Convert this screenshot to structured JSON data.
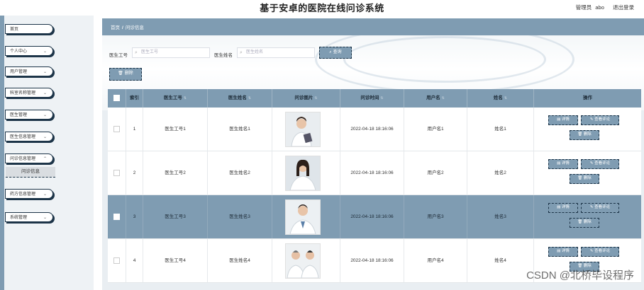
{
  "app": {
    "title": "基于安卓的医院在线问诊系统"
  },
  "topbar": {
    "role": "管理员",
    "username": "abo",
    "logout_label": "退出登录"
  },
  "sidebar": {
    "items": [
      {
        "label": "首页",
        "has_chevron": false
      },
      {
        "label": "个人中心",
        "has_chevron": true
      },
      {
        "label": "用户管理",
        "has_chevron": true
      },
      {
        "label": "科室名称管理",
        "has_chevron": true
      },
      {
        "label": "医生管理",
        "has_chevron": true
      },
      {
        "label": "医生信息管理",
        "has_chevron": true
      },
      {
        "label": "问诊信息管理",
        "has_chevron": true
      },
      {
        "label": "药方信息管理",
        "has_chevron": true
      },
      {
        "label": "系统管理",
        "has_chevron": true
      }
    ],
    "active_sub": "问诊信息"
  },
  "breadcrumb": {
    "home": "首页",
    "sep": "/",
    "current": "问诊信息"
  },
  "search": {
    "field1_label": "医生工号",
    "field1_placeholder": "医生工号",
    "field2_label": "医生姓名",
    "field2_placeholder": "医生姓名",
    "search_button": "查询",
    "delete_button": "删除"
  },
  "table": {
    "headers": {
      "index": "索引",
      "doctor_no": "医生工号",
      "doctor_name": "医生姓名",
      "photo": "问诊图片",
      "time": "问诊时间",
      "username": "用户名",
      "name": "姓名",
      "ops": "操作"
    },
    "rows": [
      {
        "index": "1",
        "doctor_no": "医生工号1",
        "doctor_name": "医生姓名1",
        "time": "2022-04-18 18:16:06",
        "username": "用户名1",
        "name": "姓名1"
      },
      {
        "index": "2",
        "doctor_no": "医生工号2",
        "doctor_name": "医生姓名2",
        "time": "2022-04-18 18:16:06",
        "username": "用户名2",
        "name": "姓名2"
      },
      {
        "index": "3",
        "doctor_no": "医生工号3",
        "doctor_name": "医生姓名3",
        "time": "2022-04-18 18:16:06",
        "username": "用户名3",
        "name": "姓名3"
      },
      {
        "index": "4",
        "doctor_no": "医生工号4",
        "doctor_name": "医生姓名4",
        "time": "2022-04-18 18:16:06",
        "username": "用户名4",
        "name": "姓名4"
      }
    ],
    "ops": {
      "detail": "详情",
      "view_comment": "查看评论",
      "delete": "删除"
    }
  },
  "watermark": "CSDN @北桥毕设程序"
}
